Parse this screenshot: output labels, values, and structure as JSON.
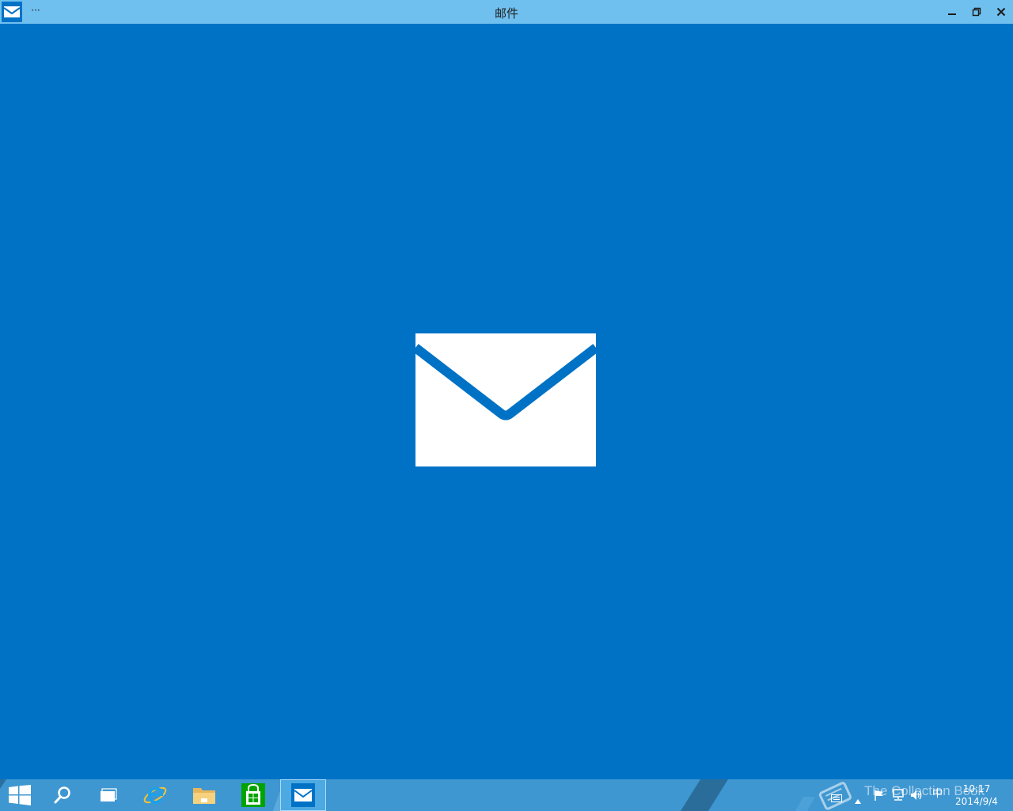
{
  "window": {
    "title": "邮件",
    "more_label": "···",
    "app_icon": "mail-icon"
  },
  "taskbar": {
    "items": [
      {
        "name": "start",
        "icon": "windows-logo-icon"
      },
      {
        "name": "search",
        "icon": "search-icon"
      },
      {
        "name": "task-view",
        "icon": "task-view-icon"
      },
      {
        "name": "internet-explorer",
        "icon": "internet-explorer-icon"
      },
      {
        "name": "file-explorer",
        "icon": "folder-icon"
      },
      {
        "name": "store",
        "icon": "store-icon"
      },
      {
        "name": "mail",
        "icon": "mail-icon",
        "active": true
      }
    ],
    "tray": {
      "ime": "中",
      "time": "10:17",
      "date": "2014/9/4"
    },
    "watermark": "The Collection Book"
  },
  "colors": {
    "accent": "#0072c6",
    "titlebar": "#70c0ef",
    "taskbar": "#3f97d1",
    "store_green": "#00a300"
  }
}
